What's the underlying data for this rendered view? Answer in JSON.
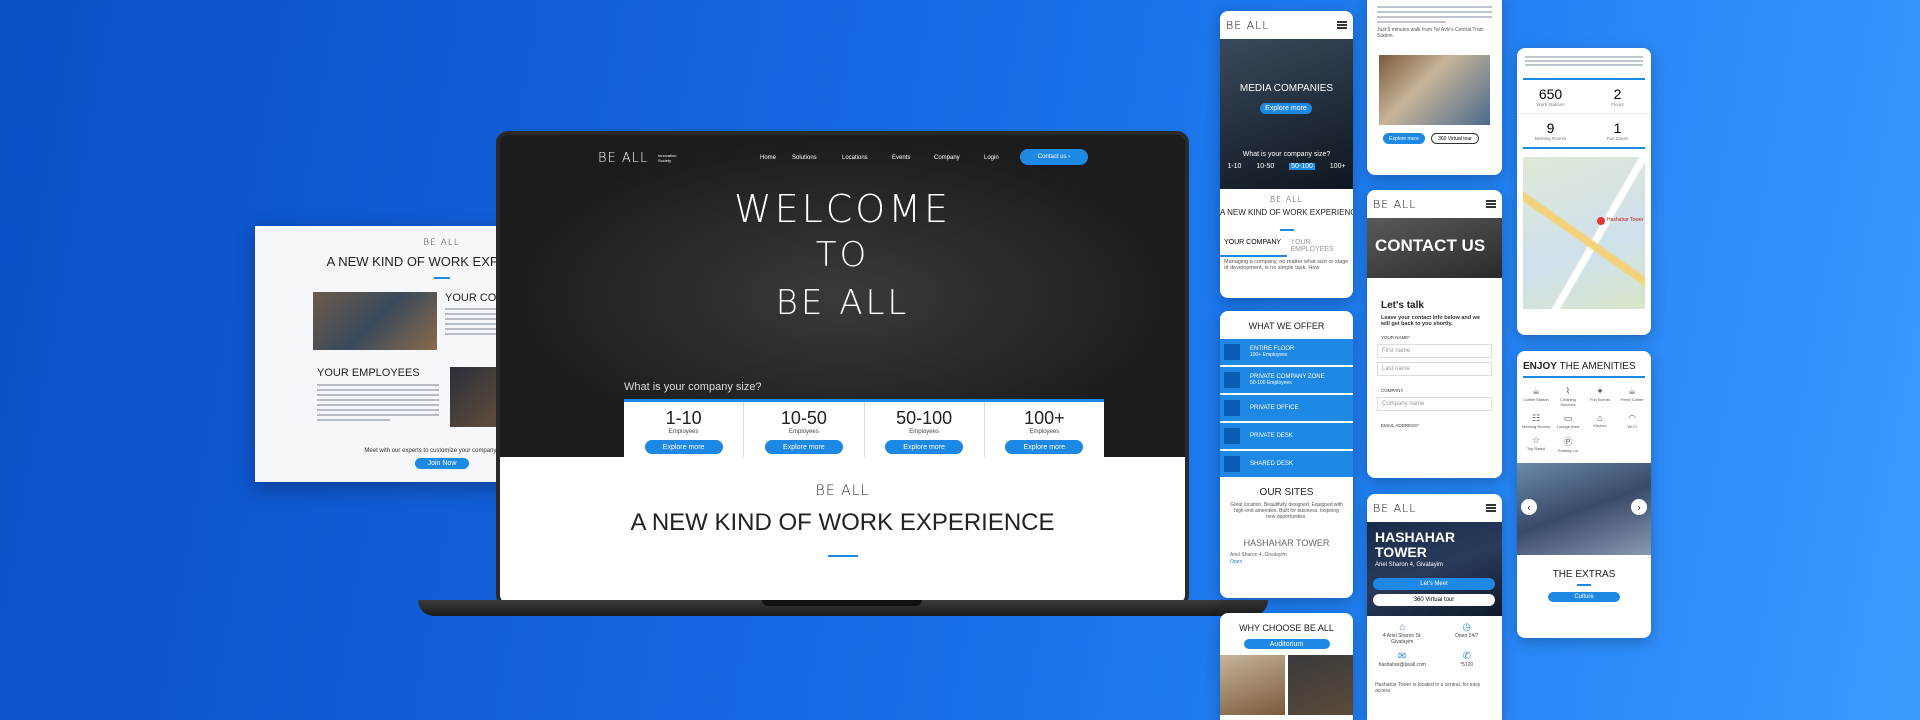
{
  "colors": {
    "accent": "#1e88e5",
    "dark": "#1c1c1c"
  },
  "brand": {
    "logo": "BE ALL",
    "tagline": "Innovation Society"
  },
  "nav": {
    "items": [
      "Home",
      "Solutions",
      "Locations",
      "Events",
      "Company",
      "Login"
    ],
    "cta": "Contact us"
  },
  "hero": {
    "welcome_1": "WELCOME",
    "welcome_2": "TO",
    "welcome_3": "BE ALL",
    "question": "What is your company size?",
    "sizes": [
      {
        "num": "1-10",
        "sub": "Employees",
        "btn": "Explore more"
      },
      {
        "num": "10-50",
        "sub": "Employees",
        "btn": "Explore more"
      },
      {
        "num": "50-100",
        "sub": "Employees",
        "btn": "Explore more"
      },
      {
        "num": "100+",
        "sub": "Employees",
        "btn": "Explore more"
      }
    ]
  },
  "section": {
    "logo": "BE ALL",
    "title": "A NEW KIND OF WORK EXPERIENCE"
  },
  "card": {
    "logo": "BE ALL",
    "title": "A NEW KIND OF WORK EXPERIENCE",
    "your_company": "YOUR COMPANY",
    "your_employees": "YOUR EMPLOYEES",
    "footer": "Meet with our experts to customize your company's needs",
    "btn": "Join Now"
  },
  "phone1": {
    "hero_text": "MEDIA COMPANIES",
    "hero_btn": "Explore more",
    "question": "What is your company size?",
    "sizes": [
      "1-10",
      "10-50",
      "50-100",
      "100+"
    ],
    "logo": "BE ALL",
    "title": "A NEW KIND OF WORK EXPERIENCE",
    "tab1": "YOUR COMPANY",
    "tab2": "YOUR EMPLOYEES",
    "body": "Managing a company, no matter what size or stage of development, is no simple task. How"
  },
  "phone2": {
    "title": "WHAT WE OFFER",
    "offers": [
      {
        "label": "ENTIRE FLOOR",
        "sub": "100+ Employees"
      },
      {
        "label": "PRIVATE COMPANY ZONE",
        "sub": "50-100 Employees"
      },
      {
        "label": "PRIVATE OFFICE",
        "sub": ""
      },
      {
        "label": "PRIVATE DESK",
        "sub": ""
      },
      {
        "label": "SHARED DESK",
        "sub": ""
      }
    ],
    "sites_title": "OUR SITES",
    "sites_body": "Great location. Beautifully designed. Equipped with high-end amenities. Built for business. Inspiring new opportunities.",
    "site_name": "HASHAHAR TOWER",
    "site_addr": "Ariel Sharon 4, Givatayim",
    "site_link": "Open"
  },
  "phone3": {
    "title": "WHY CHOOSE BE ALL",
    "tab": "Auditorium"
  },
  "phone4": {
    "text": "Just 5 minutes walk from Tel Aviv's Central Train Station.",
    "btn1": "Explore more",
    "btn2": "360 Virtual tour"
  },
  "phone5": {
    "logo": "BE ALL",
    "hero": "CONTACT US",
    "lets_talk": "Let's talk",
    "intro": "Leave your contact info below and we will get back to you shortly.",
    "your_name": "YOUR NAME*",
    "first": "First name",
    "last": "Last name",
    "company_lbl": "COMPANY",
    "company_ph": "Company name",
    "email_lbl": "EMAIL ADDRESS*"
  },
  "phone6": {
    "logo": "BE ALL",
    "tower": "HASHAHAR TOWER",
    "addr": "Ariel Sharon 4, Givatayim",
    "btn1": "Let's Meet",
    "btn2": "360 Virtual tour",
    "info": [
      "4 Ariel Sharon St. Givatayim",
      "Open 24/7",
      "hashahar@beall.com",
      "*5120"
    ],
    "foot": "Hashahar Tower is located in a central, for easy access"
  },
  "phone7": {
    "stats": [
      {
        "num": "650",
        "lbl": "Work Stations"
      },
      {
        "num": "2",
        "lbl": "Floors"
      },
      {
        "num": "9",
        "lbl": "Meeting Rooms"
      },
      {
        "num": "1",
        "lbl": "Fun Zones"
      }
    ],
    "map_label": "Hashahar Tower"
  },
  "phone8": {
    "title_bold": "ENJOY",
    "title_rest": " THE AMENITIES",
    "amenities": [
      "Coffee Station",
      "Cleaning Services",
      "Fun Events",
      "Fresh Coffee",
      "Meeting Rooms",
      "Lounge Area",
      "Kitchen",
      "Wi-Fi",
      "Top Rated",
      "Parking Lot"
    ],
    "extras": "THE EXTRAS",
    "btn": "Culture"
  }
}
